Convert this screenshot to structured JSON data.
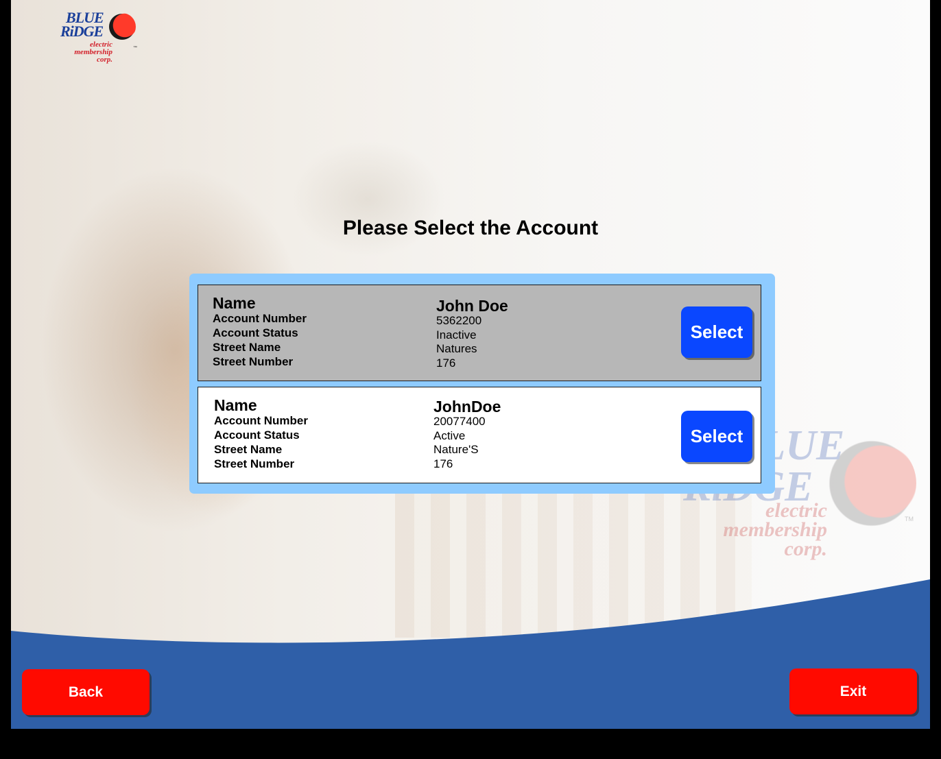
{
  "logo": {
    "line1": "BLUE",
    "line2": "RiDGE",
    "line3": "electric",
    "line4": "membership",
    "line5": "corp.",
    "tm": "™"
  },
  "watermark": {
    "line1": "BLUE",
    "line2": "RiDGE",
    "line3": "electric",
    "line4": "membership",
    "line5": "corp.",
    "tm": "TM"
  },
  "page": {
    "title": "Please Select the Account"
  },
  "labels": {
    "name": "Name",
    "account_number": "Account Number",
    "account_status": "Account Status",
    "street_name": "Street Name",
    "street_number": "Street Number"
  },
  "accounts": [
    {
      "name": "John Doe",
      "account_number": "5362200",
      "account_status": "Inactive",
      "street_name": "Natures",
      "street_number": "176",
      "select_label": "Select"
    },
    {
      "name": "JohnDoe",
      "account_number": "20077400",
      "account_status": "Active",
      "street_name": "Nature'S",
      "street_number": "176",
      "select_label": "Select"
    }
  ],
  "footer": {
    "back_label": "Back",
    "exit_label": "Exit"
  },
  "colors": {
    "panel": "#8ecbff",
    "select_button": "#0a47ff",
    "nav_button": "#ff0a00",
    "swoosh": "#2f5fa8"
  }
}
